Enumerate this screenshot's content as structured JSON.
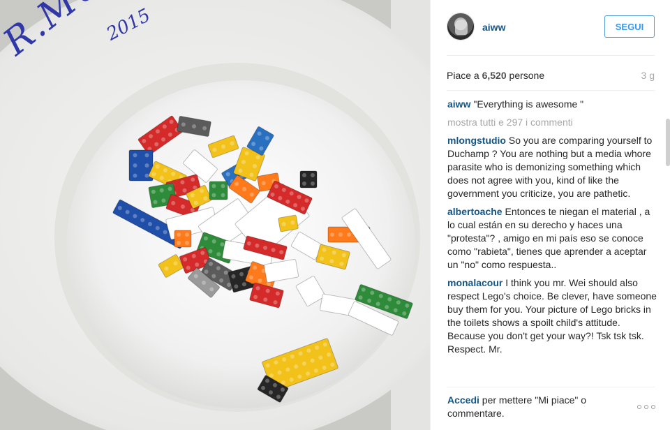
{
  "photo": {
    "description_icon": "photo-icon",
    "graffiti_name": "R.MUTT",
    "graffiti_year": "2015"
  },
  "post": {
    "username": "aiww",
    "follow_label": "SEGUI",
    "likes_prefix": "Piace a ",
    "likes_count": "6,520",
    "likes_suffix": " persone",
    "time_ago": "3 g",
    "caption_user": "aiww",
    "caption_text": "\"Everything is awesome \"",
    "show_all": "mostra tutti e 297 i commenti",
    "comments": [
      {
        "user": "mlongstudio",
        "text": "So you are comparing yourself to Duchamp ? You are nothing but a media whore parasite who is demonizing something which does not agree with you, kind of like the government you criticize, you are pathetic."
      },
      {
        "user": "albertoache",
        "text": "Entonces te niegan el material , a lo cual están en su derecho y haces una \"protesta\"? , amigo en mi país eso se conoce como \"rabieta\", tienes que aprender a aceptar un \"no\" como respuesta.."
      },
      {
        "user": "monalacour",
        "text": "I think you mr. Wei should also respect Lego's choice. Be clever, have someone buy them for you. Your picture of Lego bricks in the toilets shows a spoilt child's attitude. Because you don't get your way?! Tsk tsk tsk. Respect. Mr."
      }
    ],
    "login_link": "Accedi",
    "login_text": " per mettere \"Mi piace\" o commentare."
  },
  "colors": {
    "link": "#125688",
    "follow": "#3897f0",
    "muted": "#a5a7aa"
  }
}
